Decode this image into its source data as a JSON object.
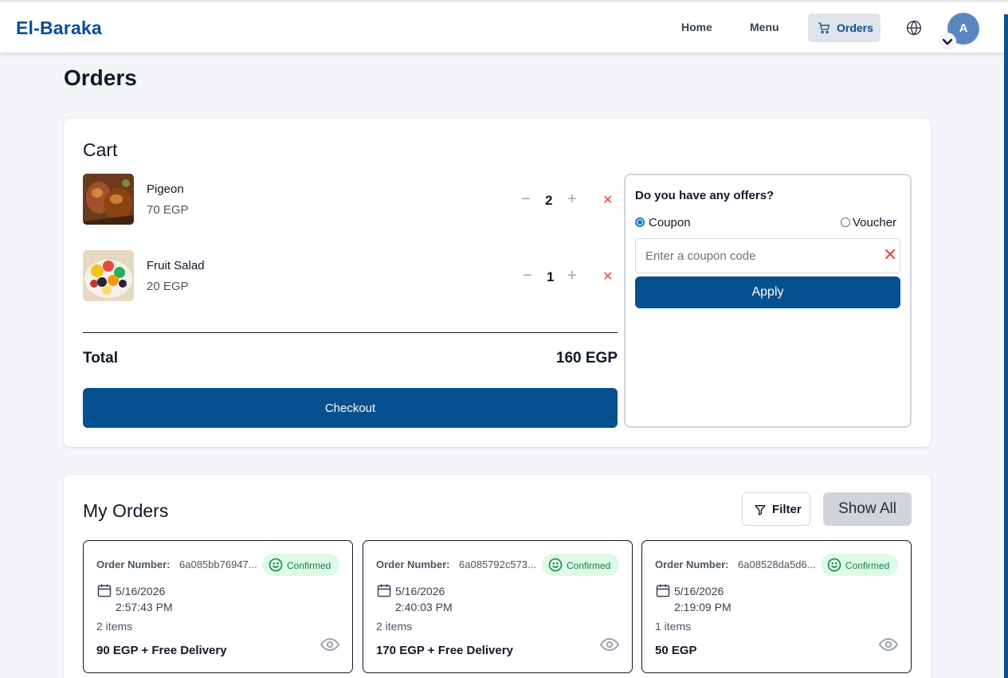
{
  "header": {
    "brand": "El-Baraka",
    "nav": {
      "home": "Home",
      "menu": "Menu",
      "orders": "Orders"
    },
    "avatar_initial": "A",
    "accent_color": "#0b4f93"
  },
  "page_title": "Orders",
  "cart": {
    "title": "Cart",
    "items": [
      {
        "name": "Pigeon",
        "price": "70 EGP",
        "qty": "2"
      },
      {
        "name": "Fruit Salad",
        "price": "20 EGP",
        "qty": "1"
      }
    ],
    "total_label": "Total",
    "total_value": "160 EGP",
    "checkout_label": "Checkout",
    "offers": {
      "question": "Do you have any offers?",
      "coupon_label": "Coupon",
      "voucher_label": "Voucher",
      "selected": "Coupon",
      "input_placeholder": "Enter a coupon code",
      "input_value": "",
      "apply_label": "Apply"
    }
  },
  "my_orders": {
    "title": "My Orders",
    "filter_label": "Filter",
    "show_all_label": "Show All",
    "order_number_label": "Order Number:",
    "orders": [
      {
        "number": "6a085bb76947...",
        "status": "Confirmed",
        "date": "5/16/2026",
        "time": "2:57:43 PM",
        "items": "2 items",
        "price": "90 EGP + Free Delivery"
      },
      {
        "number": "6a085792c573...",
        "status": "Confirmed",
        "date": "5/16/2026",
        "time": "2:40:03 PM",
        "items": "2 items",
        "price": "170 EGP + Free Delivery"
      },
      {
        "number": "6a08528da5d6...",
        "status": "Confirmed",
        "date": "5/16/2026",
        "time": "2:19:09 PM",
        "items": "1 items",
        "price": "50 EGP"
      }
    ]
  }
}
